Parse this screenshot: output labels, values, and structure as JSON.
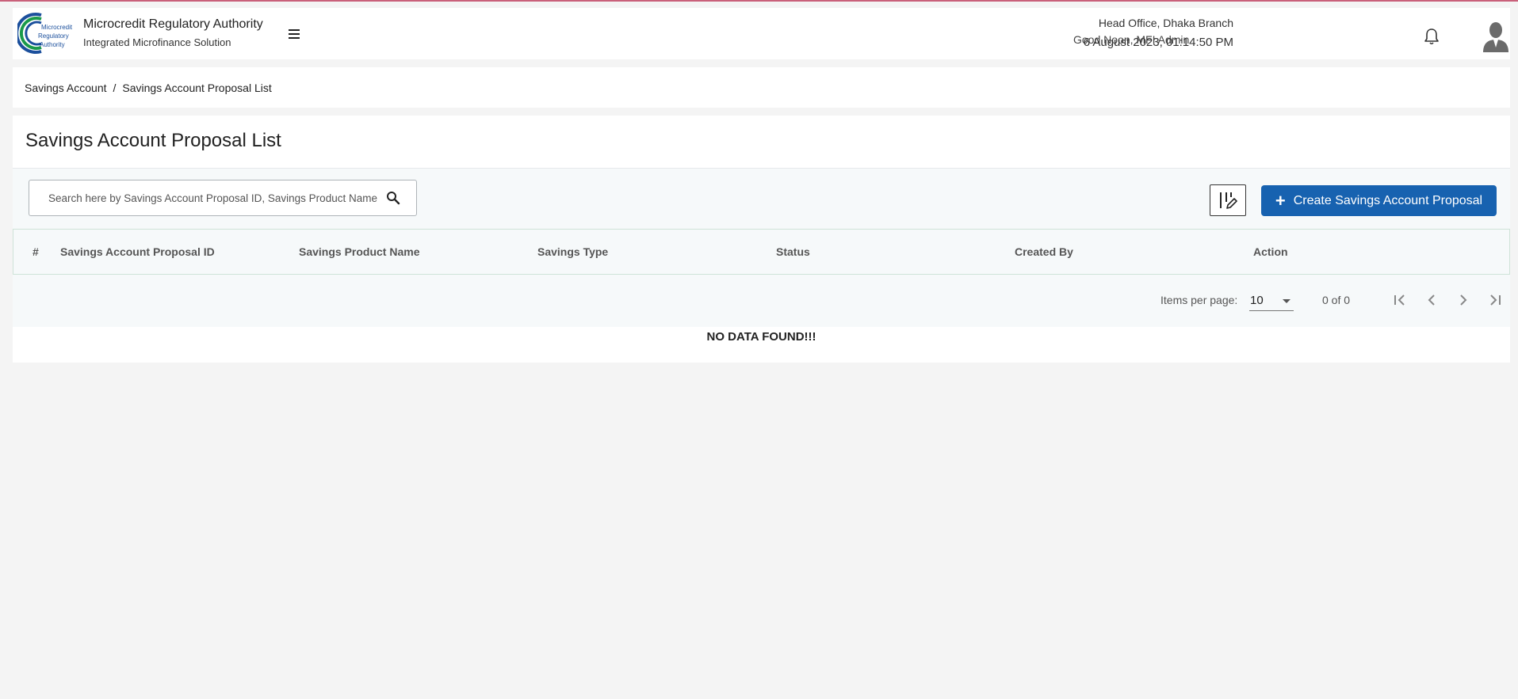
{
  "header": {
    "org_name": "Microcredit Regulatory Authority",
    "app_name": "Integrated Microfinance Solution",
    "logo_text": [
      "Microcredit",
      "Regulatory",
      "Authority"
    ],
    "greeting": "Good Noon, MFI Admin",
    "branch": "Head Office, Dhaka Branch",
    "datetime": "6 August 2023, 01:14:50 PM"
  },
  "breadcrumb": {
    "parent": "Savings Account",
    "separator": "/",
    "current": "Savings Account Proposal List"
  },
  "page": {
    "title": "Savings Account Proposal List"
  },
  "search": {
    "placeholder": "Search here by Savings Account Proposal ID, Savings Product Name & "
  },
  "actions": {
    "create_label": "Create Savings Account Proposal"
  },
  "table": {
    "columns": [
      "#",
      "Savings Account Proposal ID",
      "Savings Product Name",
      "Savings Type",
      "Status",
      "Created By",
      "Action"
    ],
    "rows": [],
    "empty_text": "NO DATA FOUND!!!"
  },
  "paginator": {
    "items_per_page_label": "Items per page:",
    "items_per_page": "10",
    "range_label": "0 of 0"
  },
  "colors": {
    "primary": "#1762b0",
    "top_strip": "#c9607a",
    "logo_green": "#1a9a4a",
    "logo_blue": "#1b4f9c"
  }
}
